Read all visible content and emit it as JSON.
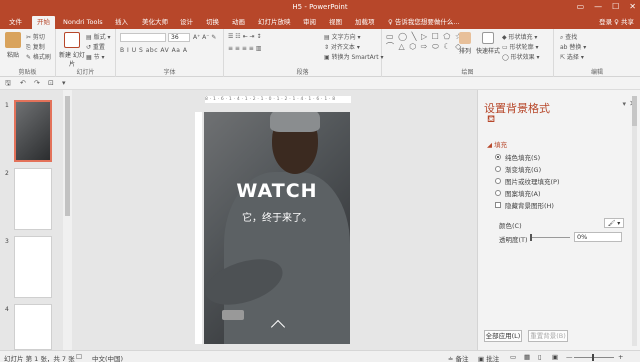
{
  "window": {
    "title": "H5 - PowerPoint",
    "controls": [
      "▭",
      "—",
      "☐",
      "✕"
    ]
  },
  "tabs": {
    "file": "文件",
    "items": [
      "开始",
      "Nondri Tools",
      "插入",
      "美化大师",
      "设计",
      "切换",
      "动画",
      "幻灯片放映",
      "审阅",
      "视图",
      "加载项"
    ],
    "tell_me": "♀ 告诉我您想要做什么...",
    "share": "登录  ♀ 共享"
  },
  "ribbon": {
    "clipboard": {
      "label": "剪贴板",
      "paste": "粘贴",
      "cut": "✂ 剪切",
      "copy": "⎘ 复制",
      "format": "✎ 格式刷"
    },
    "slides": {
      "label": "幻灯片",
      "new_slide": "新建\n幻灯片",
      "layout": "▤ 版式 ▾",
      "reset": "↺ 重置",
      "section": "▦ 节 ▾"
    },
    "font": {
      "label": "字体",
      "size": "36",
      "buttons": "B  I  U  S  abc  AV  Aa  A"
    },
    "paragraph": {
      "label": "段落",
      "text_dir": "▤ 文字方向 ▾",
      "align_text": "⇕ 对齐文本 ▾",
      "smartart": "▣ 转换为 SmartArt ▾"
    },
    "drawing": {
      "label": "绘图",
      "arrange": "排列",
      "quick_styles": "快速样式",
      "fill": "◆ 形状填充 ▾",
      "outline": "▭ 形状轮廓 ▾",
      "effects": "◯ 形状效果 ▾"
    },
    "editing": {
      "label": "编辑",
      "find": "⌕ 查找",
      "replace": "ab 替换 ▾",
      "select": "⇱ 选择 ▾"
    }
  },
  "qat": {
    "save": "🖫",
    "undo": "↶",
    "redo": "↷",
    "start": "⊡",
    "more": "▾"
  },
  "slides": [
    {
      "num": "1"
    },
    {
      "num": "2"
    },
    {
      "num": "3"
    },
    {
      "num": "4"
    }
  ],
  "ruler": {
    "h_marks": "8 · 1 · 6 · 1 · 4 · 1 · 2 · 1 · 0 · 1 · 2 · 1 · 4 · 1 · 6 · 1 · 8"
  },
  "slide": {
    "headline": "WATCH",
    "subline": "它，终于来了。"
  },
  "pane": {
    "title": "设置背景格式",
    "dropdown": "▾",
    "close": "✕",
    "section": "◢ 填充",
    "options": [
      "纯色填充(S)",
      "渐变填充(G)",
      "图片或纹理填充(P)",
      "图案填充(A)"
    ],
    "hide_graphics": "隐藏背景图形(H)",
    "color_label": "颜色(C)",
    "color_button": "🖌 ▾",
    "transparency_label": "透明度(T)",
    "transparency_value": "0%",
    "apply_all": "全部应用(L)",
    "reset_bg": "重置背景(B)"
  },
  "status": {
    "slide_info": "幻灯片 第 1 张，共 7 张",
    "lang": "中文(中国)",
    "notes": "≐ 备注",
    "comments": "▣ 批注",
    "zoom_minus": "—",
    "zoom_plus": "+"
  }
}
